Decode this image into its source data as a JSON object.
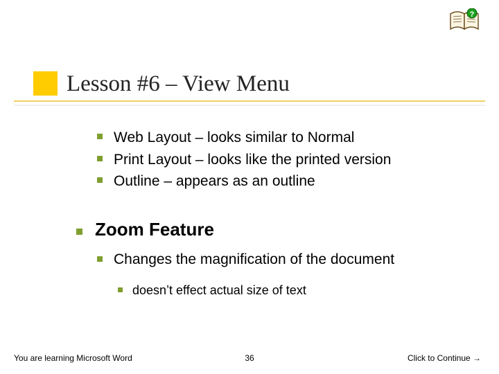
{
  "title": "Lesson #6 – View Menu",
  "bullets": {
    "group1": [
      "Web Layout – looks similar to Normal",
      "Print Layout – looks like the printed version",
      "Outline – appears as an outline"
    ],
    "zoom_title": "Zoom Feature",
    "zoom_sub": "Changes the magnification of the document",
    "zoom_sub2": "doesn’t effect actual size of text"
  },
  "footer": {
    "left": "You are learning Microsoft Word",
    "center": "36",
    "right": "Click to Continue →"
  }
}
